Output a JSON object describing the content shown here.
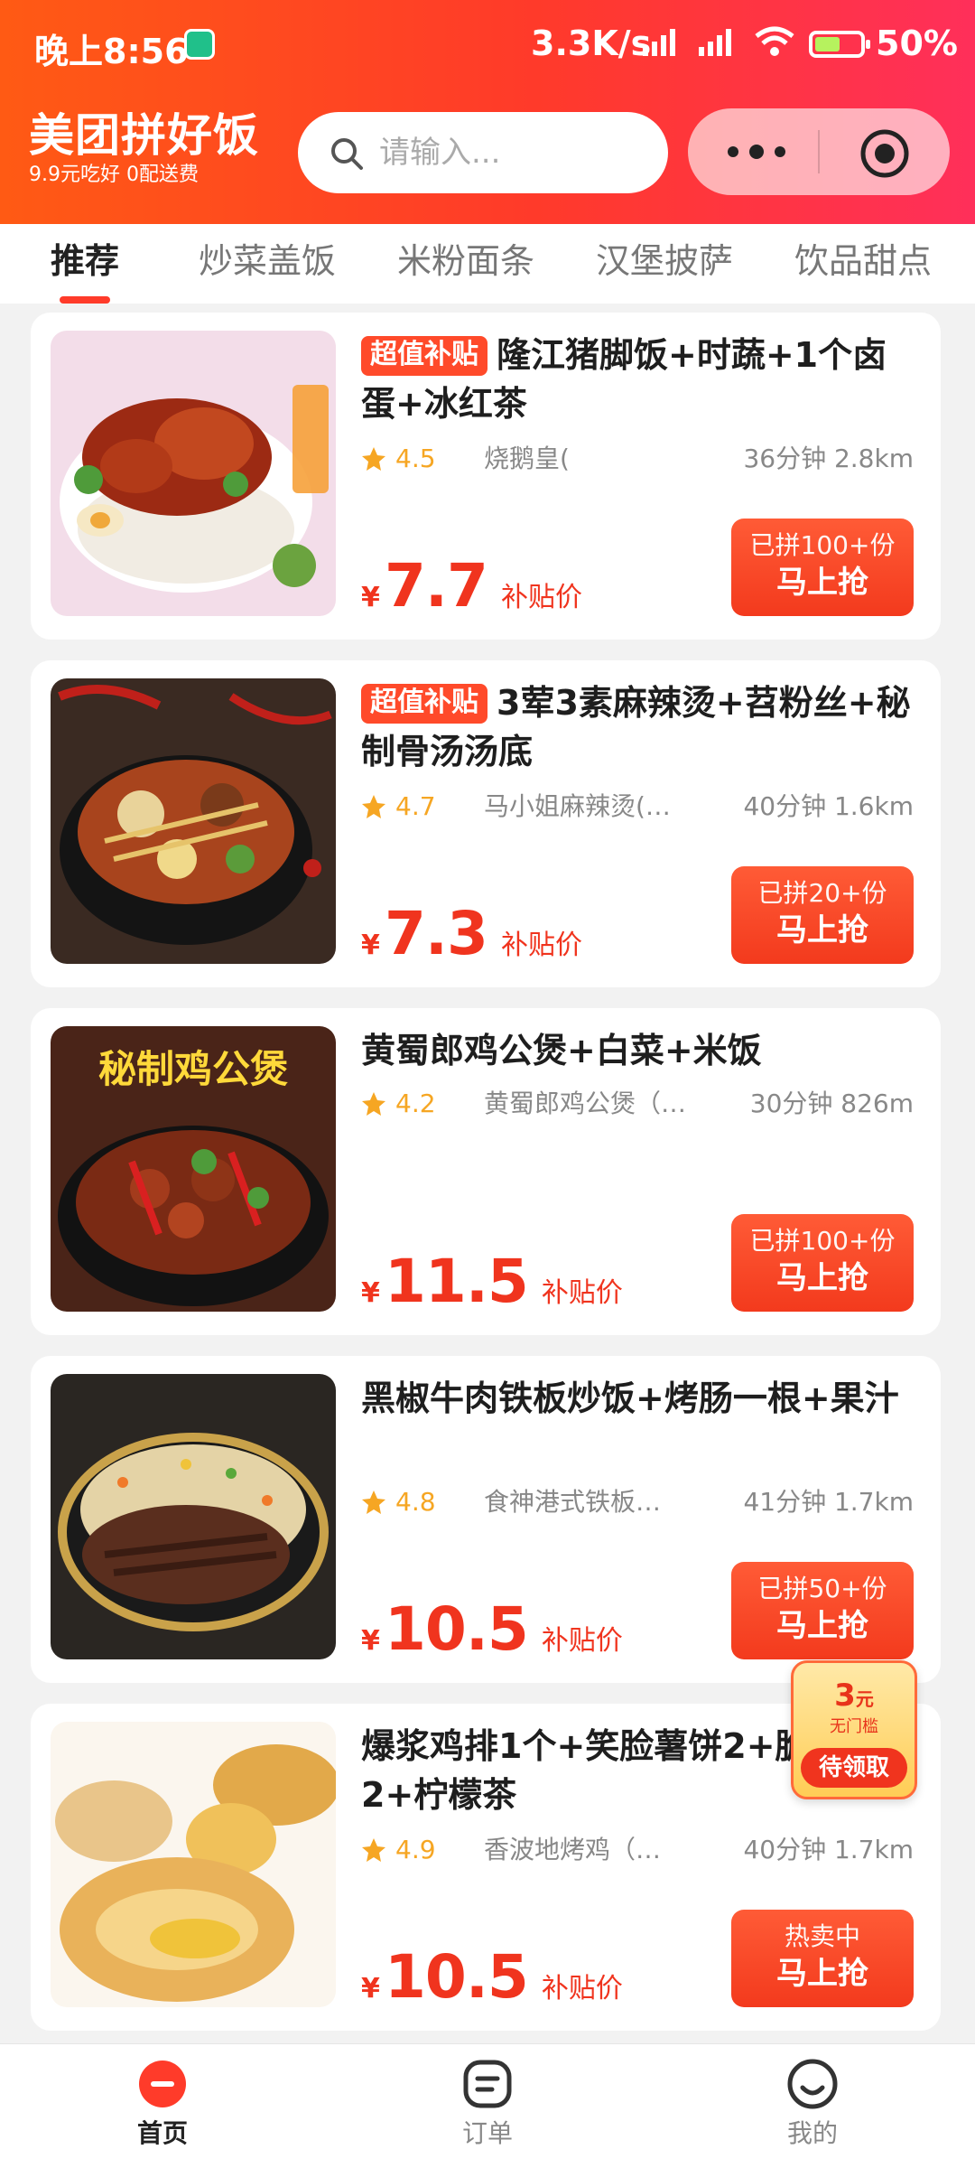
{
  "status_bar": {
    "time": "晚上8:56",
    "network_speed": "3.3K/s",
    "battery": "50%"
  },
  "header": {
    "brand_title": "美团拼好饭",
    "brand_subtitle": "9.9元吃好 0配送费",
    "search_placeholder": "请输入..."
  },
  "tabs": [
    "推荐",
    "炒菜盖饭",
    "米粉面条",
    "汉堡披萨",
    "饮品甜点"
  ],
  "products": [
    {
      "tag": "超值补贴",
      "title": "隆江猪脚饭+时蔬+1个卤蛋+冰红茶",
      "rating": "4.5",
      "shop": "烧鹅皇(",
      "eta": "36分钟  2.8km",
      "price_symbol": "¥",
      "price": "7.7",
      "price_label": "补贴价",
      "sold": "已拼100+份",
      "button": "马上抢"
    },
    {
      "tag": "超值补贴",
      "title": "3荤3素麻辣烫+苕粉丝+秘制骨汤汤底",
      "rating": "4.7",
      "shop": "马小姐麻辣烫(…",
      "eta": "40分钟  1.6km",
      "price_symbol": "¥",
      "price": "7.3",
      "price_label": "补贴价",
      "sold": "已拼20+份",
      "button": "马上抢"
    },
    {
      "tag": "",
      "title": "黄蜀郎鸡公煲+白菜+米饭",
      "rating": "4.2",
      "shop": "黄蜀郎鸡公煲（…",
      "eta": "30分钟  826m",
      "price_symbol": "¥",
      "price": "11.5",
      "price_label": "补贴价",
      "sold": "已拼100+份",
      "button": "马上抢",
      "image_text": "秘制鸡公煲"
    },
    {
      "tag": "",
      "title": "黑椒牛肉铁板炒饭+烤肠一根+果汁",
      "rating": "4.8",
      "shop": "食神港式铁板…",
      "eta": "41分钟  1.7km",
      "price_symbol": "¥",
      "price": "10.5",
      "price_label": "补贴价",
      "sold": "已拼50+份",
      "button": "马上抢"
    },
    {
      "tag": "",
      "title": "爆浆鸡排1个+笑脸薯饼2+脆饺2+柠檬茶",
      "rating": "4.9",
      "shop": "香波地烤鸡（…",
      "eta": "40分钟  1.7km",
      "price_symbol": "¥",
      "price": "10.5",
      "price_label": "补贴价",
      "sold": "热卖中",
      "button": "马上抢"
    }
  ],
  "coupon": {
    "amount": "3",
    "unit": "元",
    "desc": "无门槛",
    "button": "待领取"
  },
  "bottom_nav": [
    "首页",
    "订单",
    "我的"
  ],
  "colors": {
    "brand_orange": "#ff5a14",
    "brand_red": "#f0341e",
    "rating_yellow": "#f6a623"
  }
}
